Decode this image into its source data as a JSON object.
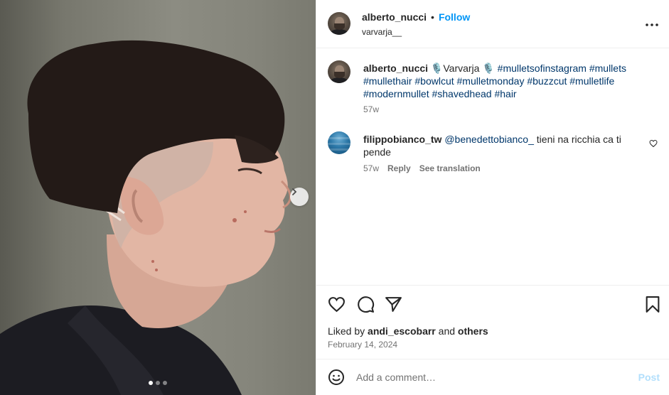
{
  "post_author": {
    "username": "alberto_nucci",
    "follow_label": "Follow",
    "separator": "•",
    "audio": "varvarja__"
  },
  "caption": {
    "username": "alberto_nucci",
    "text_prefix": "🎙️Varvarja 🎙️",
    "hashtags": "#mulletsofinstagram #mullets #mullethair #bowlcut #mulletmonday #buzzcut #mulletlife #modernmullet #shavedhead #hair",
    "age": "57w"
  },
  "comment": {
    "username": "filippobianco_tw",
    "mention": "@benedettobianco_",
    "text": " tieni na ricchia ca ti pende",
    "age": "57w",
    "reply_label": "Reply",
    "translate_label": "See translation"
  },
  "likes": {
    "prefix": "Liked by ",
    "user": "andi_escobarr",
    "middle": " and ",
    "others": "others"
  },
  "date": "February 14, 2024",
  "composer": {
    "placeholder": "Add a comment…",
    "post_label": "Post"
  },
  "carousel": {
    "count": 3,
    "active_index": 0
  },
  "icons": {
    "more": "more-horizontal-icon",
    "like": "heart-icon",
    "comment": "comment-bubble-icon",
    "share": "paper-plane-icon",
    "save": "bookmark-icon",
    "emoji": "smiley-icon",
    "next": "chevron-right-icon"
  },
  "colors": {
    "link_blue": "#0095f6",
    "hashtag": "#00376b",
    "muted": "#737373",
    "post_disabled": "#b2dffc"
  }
}
